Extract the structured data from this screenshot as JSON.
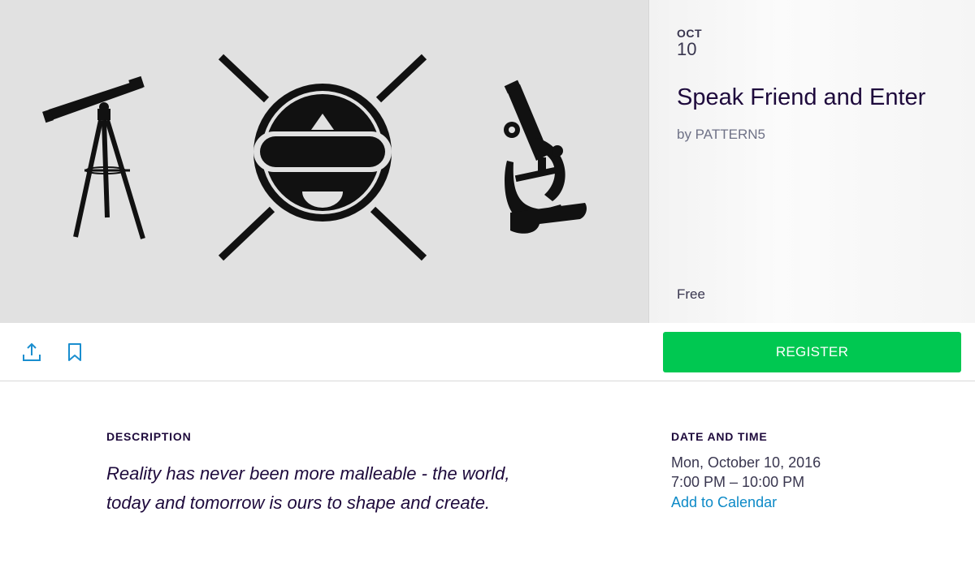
{
  "event": {
    "date_month": "OCT",
    "date_day": "10",
    "title": "Speak Friend and Enter",
    "organizer": "by PATTERN5",
    "price": "Free"
  },
  "actions": {
    "share_icon": "share-upload-icon",
    "save_icon": "bookmark-icon",
    "register_label": "REGISTER",
    "register_color": "#00c851",
    "accent_link_color": "#0d8ac7"
  },
  "description": {
    "heading": "DESCRIPTION",
    "text": "Reality has never been more malleable - the world, today and tomorrow is ours to shape and create."
  },
  "date_time": {
    "heading": "DATE AND TIME",
    "date": "Mon, October 10, 2016",
    "time": "7:00 PM – 10:00 PM",
    "calendar_link": "Add to Calendar"
  },
  "hero": {
    "icons": [
      "telescope-icon",
      "vr-headset-face-icon",
      "microscope-icon"
    ]
  }
}
